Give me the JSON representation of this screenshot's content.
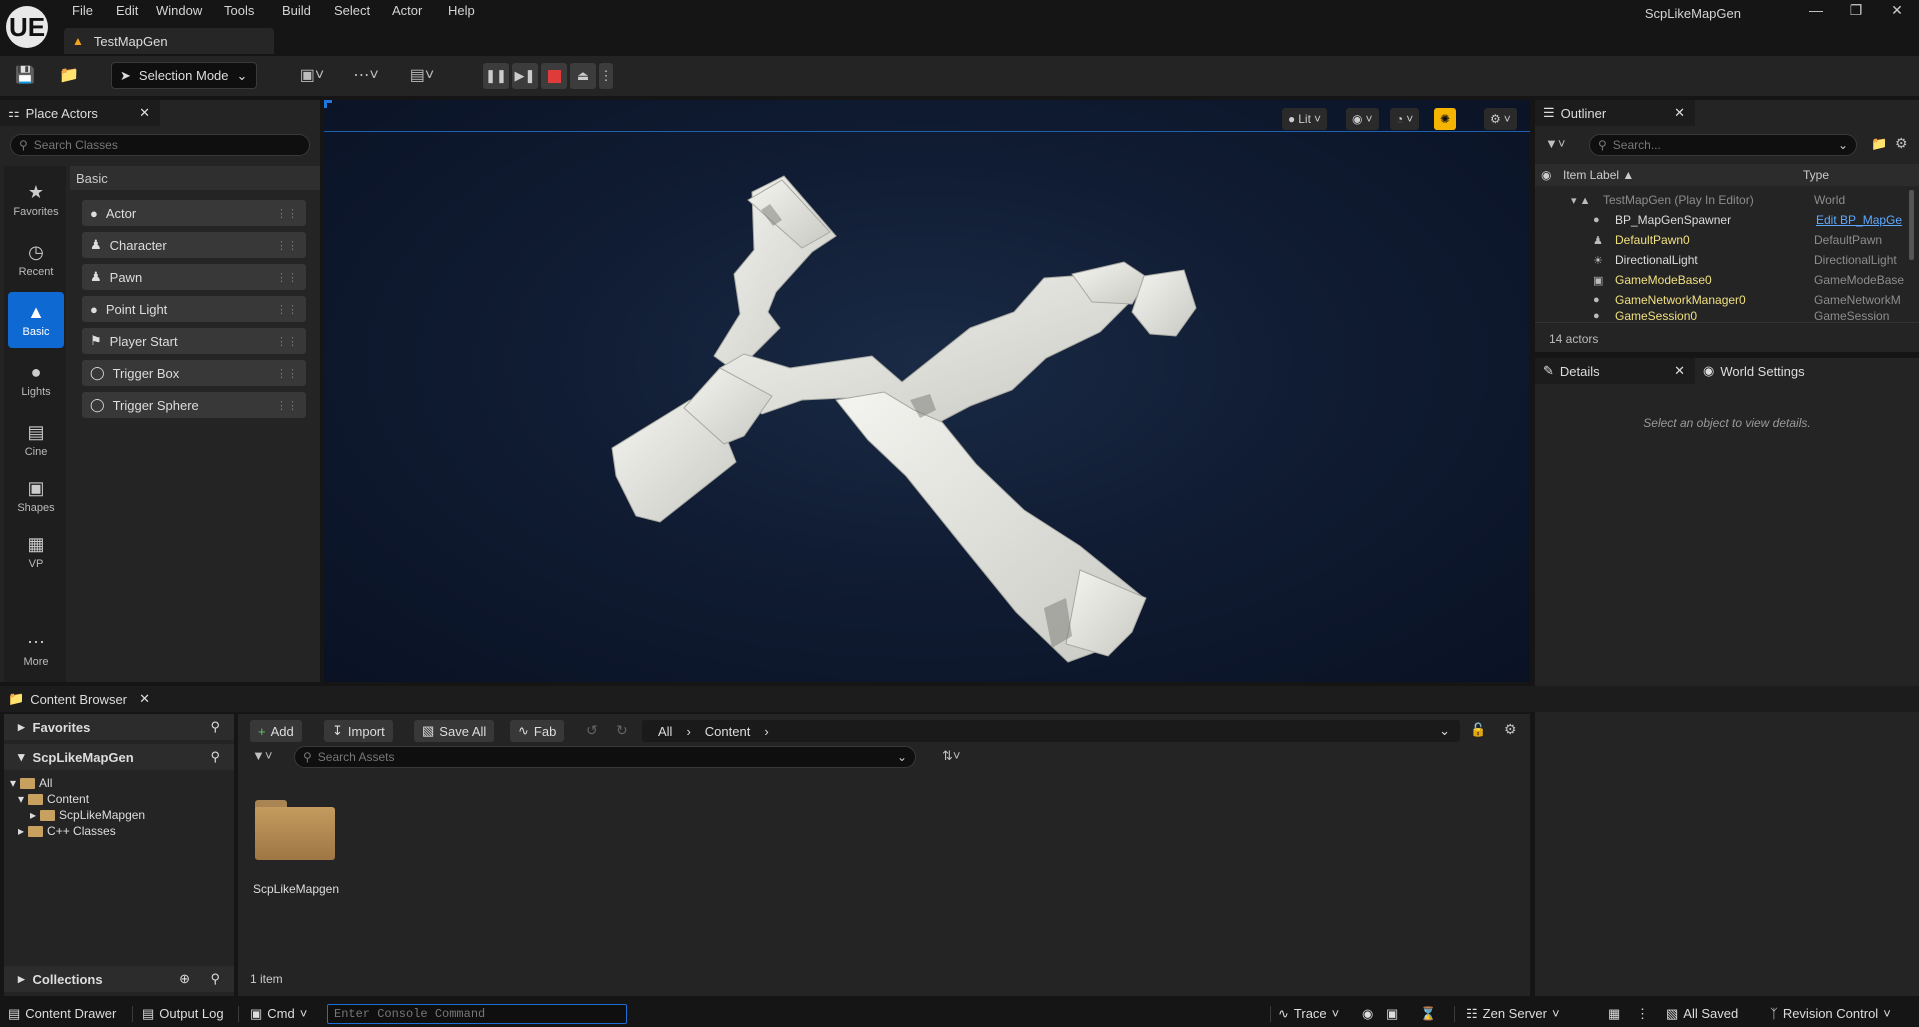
{
  "app": {
    "title": "ScpLikeMapGen",
    "logo": "UE",
    "tab": "TestMapGen"
  },
  "menu": [
    "File",
    "Edit",
    "Window",
    "Tools",
    "Build",
    "Select",
    "Actor",
    "Help"
  ],
  "toolbar": {
    "selection_mode": "Selection Mode"
  },
  "place_actors": {
    "title": "Place Actors",
    "search_placeholder": "Search Classes",
    "section": "Basic",
    "categories": [
      "Favorites",
      "Recent",
      "Basic",
      "Lights",
      "Cine",
      "Shapes",
      "VP",
      "More"
    ],
    "items": [
      "Actor",
      "Character",
      "Pawn",
      "Point Light",
      "Player Start",
      "Trigger Box",
      "Trigger Sphere"
    ]
  },
  "viewport": {
    "lit_label": "Lit"
  },
  "outliner": {
    "title": "Outliner",
    "search_placeholder": "Search...",
    "col_label": "Item Label",
    "col_type": "Type",
    "rows": [
      {
        "label": "TestMapGen (Play In Editor)",
        "type": "World"
      },
      {
        "label": "BP_MapGenSpawner",
        "type": "Edit BP_MapGe"
      },
      {
        "label": "DefaultPawn0",
        "type": "DefaultPawn"
      },
      {
        "label": "DirectionalLight",
        "type": "DirectionalLight"
      },
      {
        "label": "GameModeBase0",
        "type": "GameModeBase"
      },
      {
        "label": "GameNetworkManager0",
        "type": "GameNetworkM"
      },
      {
        "label": "GameSession0",
        "type": "GameSession"
      }
    ],
    "count": "14 actors"
  },
  "details": {
    "tab_details": "Details",
    "tab_world": "World Settings",
    "empty": "Select an object to view details."
  },
  "content_browser": {
    "title": "Content Browser",
    "favorites": "Favorites",
    "project": "ScpLikeMapGen",
    "tree": [
      "All",
      "Content",
      "ScpLikeMapgen",
      "C++ Classes"
    ],
    "collections": "Collections",
    "add": "Add",
    "import": "Import",
    "save_all": "Save All",
    "fab": "Fab",
    "path": [
      "All",
      "Content"
    ],
    "search_placeholder": "Search Assets",
    "folder": "ScpLikeMapgen",
    "item_count": "1 item"
  },
  "status": {
    "content_drawer": "Content Drawer",
    "output_log": "Output Log",
    "cmd": "Cmd",
    "console_placeholder": "Enter Console Command",
    "trace": "Trace",
    "zen": "Zen Server",
    "saved": "All Saved",
    "revision": "Revision Control"
  },
  "colors": {
    "accent": "#0e6ad2",
    "play_stop": "#e03b3b",
    "warning": "#f4b400"
  }
}
